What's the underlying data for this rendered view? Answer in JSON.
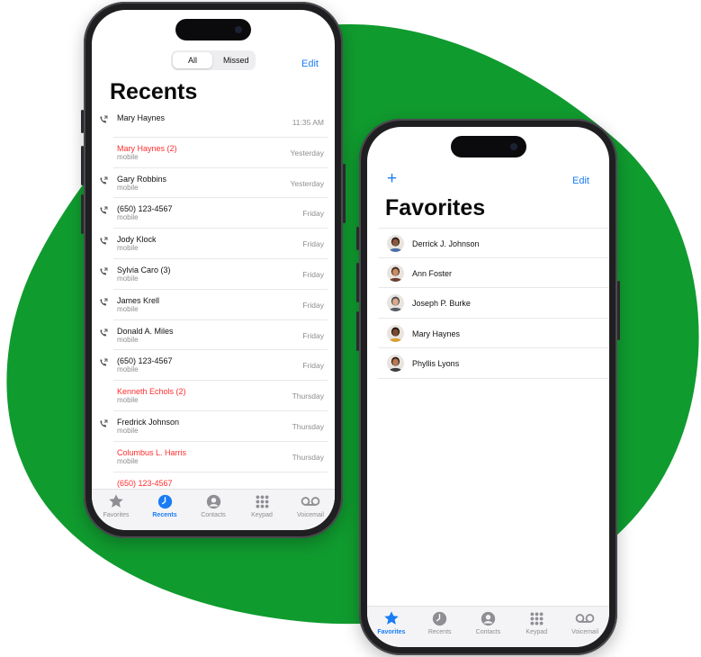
{
  "colors": {
    "accent": "#1a7cf5",
    "missed": "#ff2d2d",
    "blob": "#109b2f",
    "secondary": "#8e8e93"
  },
  "recents": {
    "segments": [
      "All",
      "Missed"
    ],
    "edit": "Edit",
    "title": "Recents",
    "calls": [
      {
        "name": "Mary Haynes",
        "type": "",
        "time": "11:35 AM",
        "missed": false,
        "icon": "outgoing-call-icon"
      },
      {
        "name": "Mary Haynes (2)",
        "type": "mobile",
        "time": "Yesterday",
        "missed": true,
        "icon": ""
      },
      {
        "name": "Gary Robbins",
        "type": "mobile",
        "time": "Yesterday",
        "missed": false,
        "icon": "outgoing-call-icon"
      },
      {
        "name": "(650) 123-4567",
        "type": "mobile",
        "time": "Friday",
        "missed": false,
        "icon": "outgoing-call-icon"
      },
      {
        "name": "Jody Klock",
        "type": "mobile",
        "time": "Friday",
        "missed": false,
        "icon": "outgoing-call-icon"
      },
      {
        "name": "Sylvia Caro (3)",
        "type": "mobile",
        "time": "Friday",
        "missed": false,
        "icon": "outgoing-call-icon"
      },
      {
        "name": "James Krell",
        "type": "mobile",
        "time": "Friday",
        "missed": false,
        "icon": "outgoing-call-icon"
      },
      {
        "name": "Donald A. Miles",
        "type": "mobile",
        "time": "Friday",
        "missed": false,
        "icon": "outgoing-call-icon"
      },
      {
        "name": "(650) 123-4567",
        "type": "mobile",
        "time": "Friday",
        "missed": false,
        "icon": "outgoing-call-icon"
      },
      {
        "name": "Kenneth Echols (2)",
        "type": "mobile",
        "time": "Thursday",
        "missed": true,
        "icon": ""
      },
      {
        "name": "Fredrick Johnson",
        "type": "mobile",
        "time": "Thursday",
        "missed": false,
        "icon": "outgoing-call-icon"
      },
      {
        "name": "Columbus L. Harris",
        "type": "mobile",
        "time": "Thursday",
        "missed": true,
        "icon": ""
      },
      {
        "name": "(650) 123-4567",
        "type": "",
        "time": "",
        "missed": true,
        "icon": ""
      }
    ],
    "tabs": [
      "Favorites",
      "Recents",
      "Contacts",
      "Keypad",
      "Voicemail"
    ],
    "active_tab": "Recents"
  },
  "favorites": {
    "add": "+",
    "edit": "Edit",
    "title": "Favorites",
    "contacts": [
      {
        "name": "Derrick J. Johnson",
        "skin": "#8a5a3c",
        "hair": "#2a1a12",
        "shirt": "#4a6fa5"
      },
      {
        "name": "Ann Foster",
        "skin": "#c98d64",
        "hair": "#3b2416",
        "shirt": "#6b3e2e"
      },
      {
        "name": "Joseph P. Burke",
        "skin": "#d9a98a",
        "hair": "#444444",
        "shirt": "#555b66"
      },
      {
        "name": "Mary Haynes",
        "skin": "#7a4a2e",
        "hair": "#1b120c",
        "shirt": "#d9a032"
      },
      {
        "name": "Phyllis Lyons",
        "skin": "#b87a55",
        "hair": "#2b1a10",
        "shirt": "#3d3d3d"
      }
    ],
    "tabs": [
      "Favorites",
      "Recents",
      "Contacts",
      "Keypad",
      "Voicemail"
    ],
    "active_tab": "Favorites"
  },
  "icons": {
    "tabs": [
      "star-icon",
      "clock-icon",
      "person-circle-icon",
      "keypad-icon",
      "voicemail-icon"
    ]
  }
}
